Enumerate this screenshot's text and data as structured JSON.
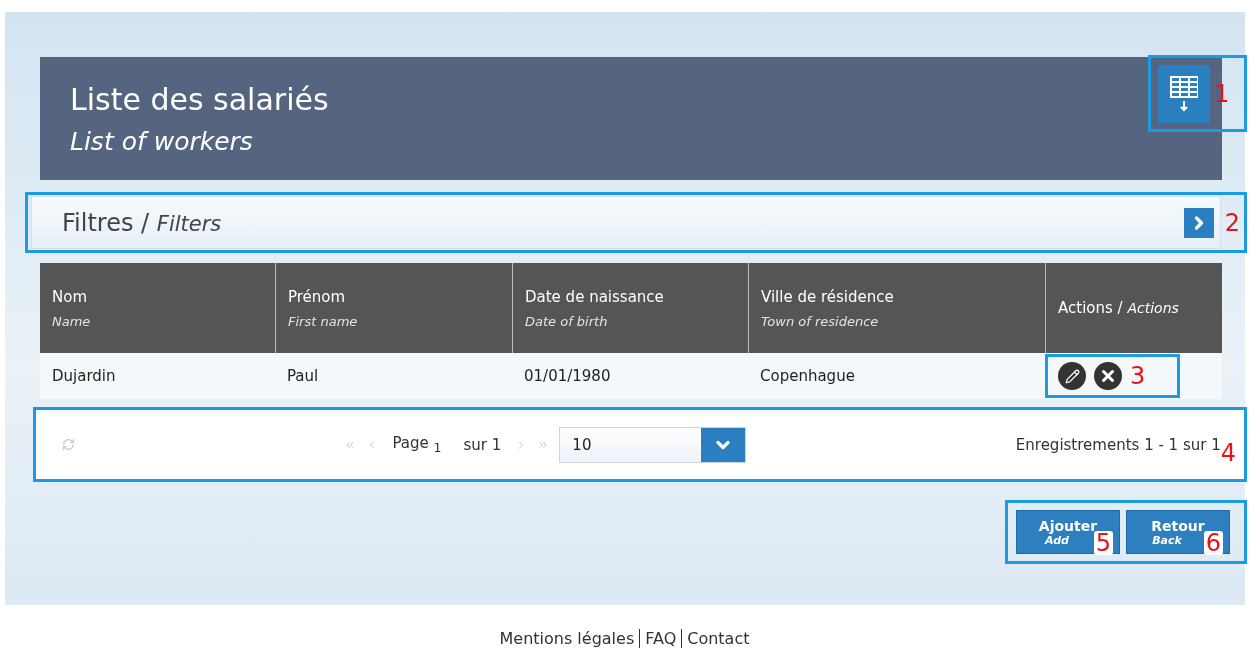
{
  "header": {
    "title": "Liste des salariés",
    "subtitle": "List of workers",
    "callout": "1"
  },
  "filters": {
    "title": "Filtres",
    "separator": "/",
    "subtitle": "Filters",
    "expanded": false,
    "callout": "2"
  },
  "table": {
    "columns": [
      {
        "label": "Nom",
        "sublabel": "Name"
      },
      {
        "label": "Prénom",
        "sublabel": "First name"
      },
      {
        "label": "Date de naissance",
        "sublabel": "Date of birth"
      },
      {
        "label": "Ville de résidence",
        "sublabel": "Town of residence"
      },
      {
        "label": "Actions",
        "separator": "/",
        "sublabel": "Actions"
      }
    ],
    "rows": [
      {
        "cells": [
          "Dujardin",
          "Paul",
          "01/01/1980",
          "Copenhague"
        ]
      }
    ],
    "actions_callout": "3"
  },
  "pagination": {
    "page_label": "Page",
    "page": "1",
    "of_label": "sur 1",
    "page_size": "10",
    "records": "Enregistrements 1 - 1 sur 1",
    "callout": "4"
  },
  "buttons": [
    {
      "label": "Ajouter",
      "sublabel": "Add",
      "callout": "5"
    },
    {
      "label": "Retour",
      "sublabel": "Back",
      "callout": "6"
    }
  ],
  "footer": {
    "links": [
      "Mentions légales",
      "FAQ",
      "Contact"
    ]
  }
}
